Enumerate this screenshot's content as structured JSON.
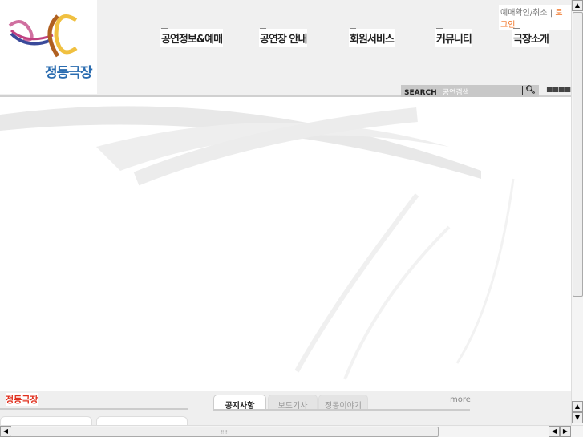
{
  "header": {
    "logo_text": "정동극장",
    "top_links": {
      "reservation": "예매확인/취소",
      "separator": "|",
      "login": "로그인"
    },
    "nav": [
      "공연정보&예매",
      "공연장 안내",
      "회원서비스",
      "커뮤니티",
      "극장소개"
    ],
    "search": {
      "label": "SEARCH",
      "placeholder": "공연검색"
    }
  },
  "bottom": {
    "brand": "정동극장",
    "tabs": [
      "공지사항",
      "보도기사",
      "정동이야기"
    ],
    "more": "more"
  }
}
